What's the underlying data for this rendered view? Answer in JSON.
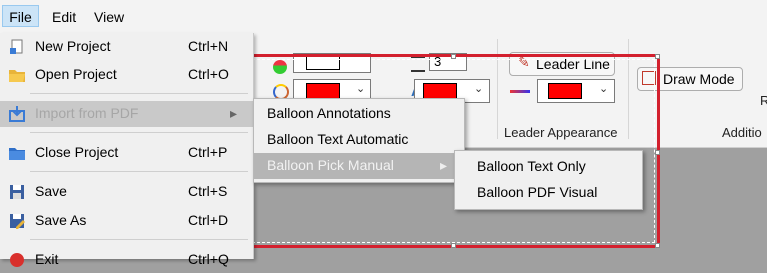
{
  "menubar": {
    "file": "File",
    "edit": "Edit",
    "view": "View"
  },
  "file_menu": {
    "items": [
      {
        "label": "New Project",
        "shortcut": "Ctrl+N",
        "icon": "new-project-icon"
      },
      {
        "label": "Open Project",
        "shortcut": "Ctrl+O",
        "icon": "folder-open-icon"
      },
      {
        "label": "Import from PDF",
        "shortcut": "",
        "icon": "import-icon",
        "state": "disabled-highlighted"
      },
      {
        "label": "Close Project",
        "shortcut": "Ctrl+P",
        "icon": "folder-blue-icon"
      },
      {
        "label": "Save",
        "shortcut": "Ctrl+S",
        "icon": "save-icon"
      },
      {
        "label": "Save As",
        "shortcut": "Ctrl+D",
        "icon": "save-as-icon"
      },
      {
        "label": "Exit",
        "shortcut": "Ctrl+Q",
        "icon": "exit-icon"
      }
    ],
    "submenu_arrow": "▸"
  },
  "import_submenu": {
    "items": [
      "Balloon Annotations",
      "Balloon Text Automatic",
      "Balloon Pick Manual"
    ],
    "arrow": "▸"
  },
  "pick_submenu": {
    "items": [
      "Balloon Text Only",
      "Balloon PDF Visual"
    ]
  },
  "ribbon": {
    "leader_line_button": "Leader Line",
    "leader_appearance_label": "Leader Appearance",
    "draw_mode_button": "Draw Mode",
    "addition_label": "Additio",
    "r_label": "R",
    "size_value": "3",
    "chevron": "⌄"
  },
  "colors": {
    "selection_red": "#d3202e",
    "swatch_red": "#ff0000",
    "menu_highlight": "#b5b5b5",
    "file_menu_hover": "#cce4f7"
  }
}
